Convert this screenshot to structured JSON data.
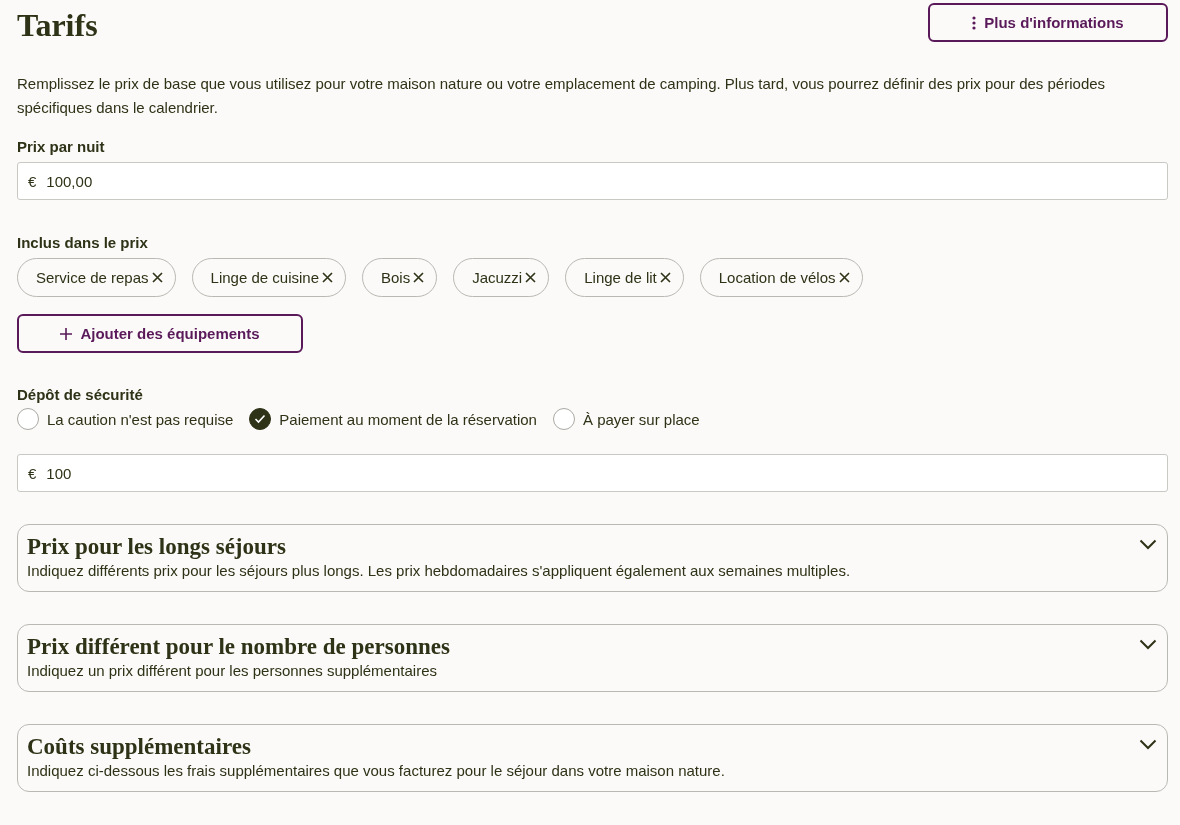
{
  "title": "Tarifs",
  "more_button": {
    "label": "Plus d'informations"
  },
  "intro": "Remplissez le prix de base que vous utilisez pour votre maison nature ou votre emplacement de camping. Plus tard, vous pourrez définir des prix pour des périodes spécifiques dans le calendrier.",
  "price_field": {
    "label": "Prix par nuit",
    "prefix": "€",
    "value": "100,00"
  },
  "included": {
    "label": "Inclus dans le prix",
    "chips": [
      {
        "label": "Service de repas"
      },
      {
        "label": "Linge de cuisine"
      },
      {
        "label": "Bois"
      },
      {
        "label": "Jacuzzi"
      },
      {
        "label": "Linge de lit"
      },
      {
        "label": "Location de vélos"
      }
    ],
    "add_button": {
      "label": "Ajouter des équipements"
    }
  },
  "deposit": {
    "label": "Dépôt de sécurité",
    "options": [
      {
        "label": "La caution n'est pas requise",
        "selected": false
      },
      {
        "label": "Paiement au moment de la réservation",
        "selected": true
      },
      {
        "label": "À payer sur place",
        "selected": false
      }
    ],
    "prefix": "€",
    "value": "100"
  },
  "sections": [
    {
      "title": "Prix pour les longs séjours",
      "description": "Indiquez différents prix pour les séjours plus longs. Les prix hebdomadaires s'appliquent également aux semaines multiples.",
      "expanded": false
    },
    {
      "title": "Prix différent pour le nombre de personnes",
      "description": "Indiquez un prix différent pour les personnes supplémentaires",
      "expanded": false
    },
    {
      "title": "Coûts supplémentaires",
      "description": "Indiquez ci-dessous les frais supplémentaires que vous facturez pour le séjour dans votre maison nature.",
      "expanded": false
    }
  ]
}
